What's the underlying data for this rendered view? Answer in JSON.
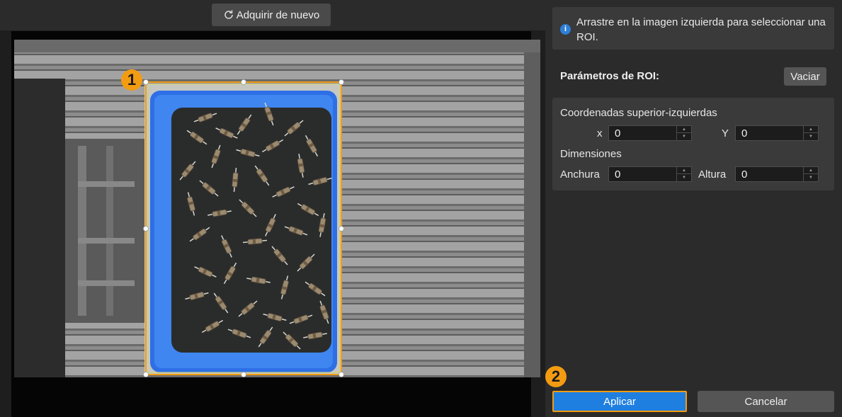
{
  "toolbar": {
    "reacquire_label": "Adquirir de nuevo",
    "reacquire_icon": "refresh-icon"
  },
  "annotations": {
    "marker1": "1",
    "marker2": "2",
    "color": "#f39c12"
  },
  "info": {
    "icon": "info-icon",
    "text": "Arrastre en la imagen izquierda para seleccionar una ROI."
  },
  "roi": {
    "title": "Parámetros de ROI:",
    "clear_label": "Vaciar",
    "top_left_label": "Coordenadas superior-izquierdas",
    "x_label": "x",
    "x_value": "0",
    "y_label": "Y",
    "y_value": "0",
    "dimensions_label": "Dimensiones",
    "width_label": "Anchura",
    "width_value": "0",
    "height_label": "Altura",
    "height_value": "0"
  },
  "actions": {
    "apply_label": "Aplicar",
    "cancel_label": "Cancelar"
  },
  "colors": {
    "accent": "#1f7fe0",
    "selection": "#f39c12",
    "bin": "#2e6fe6"
  }
}
